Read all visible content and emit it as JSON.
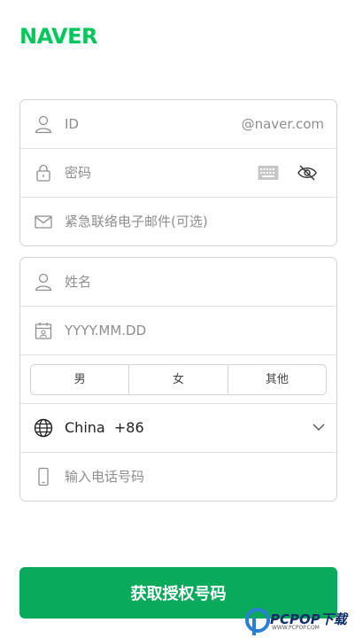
{
  "logo": "NAVER",
  "account": {
    "id_placeholder": "ID",
    "id_suffix": "@naver.com",
    "password_placeholder": "密码",
    "email_placeholder": "紧急联络电子邮件(可选)"
  },
  "profile": {
    "name_placeholder": "姓名",
    "birth_placeholder": "YYYY.MM.DD",
    "gender_options": [
      "男",
      "女",
      "其他"
    ],
    "country": "China",
    "country_code": "+86",
    "phone_placeholder": "输入电话号码"
  },
  "submit_label": "获取授权号码",
  "watermark": {
    "text": "PCPOP下载",
    "sub": "WWW.PCPOP.COM"
  },
  "colors": {
    "brand": "#03c75a",
    "button": "#09aa5c"
  },
  "icons": [
    "user-icon",
    "lock-icon",
    "keyboard-icon",
    "eye-off-icon",
    "mail-icon",
    "calendar-icon",
    "globe-icon",
    "chevron-down-icon",
    "phone-icon"
  ]
}
